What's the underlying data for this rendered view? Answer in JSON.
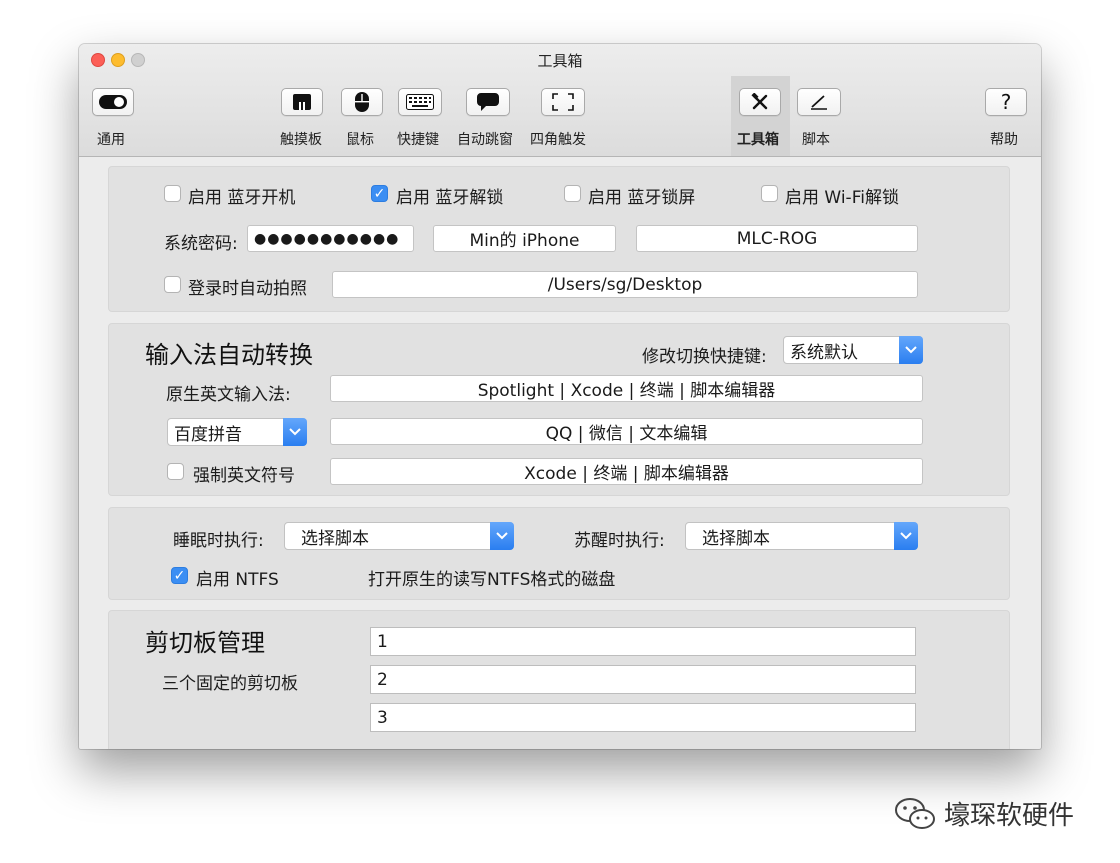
{
  "window": {
    "title": "工具箱"
  },
  "toolbar": {
    "items": [
      {
        "label": "通用",
        "icon": "toggle-icon"
      },
      {
        "label": "触摸板",
        "icon": "trackpad-icon"
      },
      {
        "label": "鼠标",
        "icon": "mouse-icon"
      },
      {
        "label": "快捷键",
        "icon": "keyboard-icon"
      },
      {
        "label": "自动跳窗",
        "icon": "speech-bubble-icon"
      },
      {
        "label": "四角触发",
        "icon": "corners-icon"
      },
      {
        "label": "工具箱",
        "icon": "tools-icon",
        "selected": true
      },
      {
        "label": "脚本",
        "icon": "pen-icon"
      },
      {
        "label": "帮助",
        "icon": "help-icon"
      }
    ],
    "help_glyph": "?"
  },
  "bluetooth": {
    "options": [
      {
        "label": "启用 蓝牙开机",
        "checked": false
      },
      {
        "label": "启用 蓝牙解锁",
        "checked": true
      },
      {
        "label": "启用 蓝牙锁屏",
        "checked": false
      },
      {
        "label": "启用 Wi-Fi解锁",
        "checked": false
      }
    ],
    "password_label": "系统密码:",
    "password_value": "●●●●●●●●●●●",
    "device1": "Min的 iPhone",
    "device2": "MLC-ROG",
    "login_photo_label": "登录时自动拍照",
    "login_photo_checked": false,
    "login_photo_path": "/Users/sg/Desktop"
  },
  "input_method": {
    "title": "输入法自动转换",
    "shortcut_label": "修改切换快捷键:",
    "shortcut_value": "系统默认",
    "native_label": "原生英文输入法:",
    "native_apps": "Spotlight | Xcode | 终端 | 脚本编辑器",
    "ime_value": "百度拼音",
    "ime_apps": "QQ | 微信 | 文本编辑",
    "force_label": "强制英文符号",
    "force_checked": false,
    "force_apps": "Xcode | 终端 | 脚本编辑器"
  },
  "sleep": {
    "sleep_label": "睡眠时执行:",
    "sleep_value": "选择脚本",
    "wake_label": "苏醒时执行:",
    "wake_value": "选择脚本",
    "ntfs_label": "启用 NTFS",
    "ntfs_checked": true,
    "ntfs_desc": "打开原生的读写NTFS格式的磁盘"
  },
  "clipboard": {
    "title": "剪切板管理",
    "subtitle": "三个固定的剪切板",
    "slots": [
      "1",
      "2",
      "3"
    ]
  },
  "watermark": {
    "text": "壕琛软硬件",
    "icon": "wechat-icon"
  },
  "colors": {
    "accent": "#3b8ef3",
    "window_bg": "#ececec",
    "group_bg": "#e1e1e1"
  }
}
